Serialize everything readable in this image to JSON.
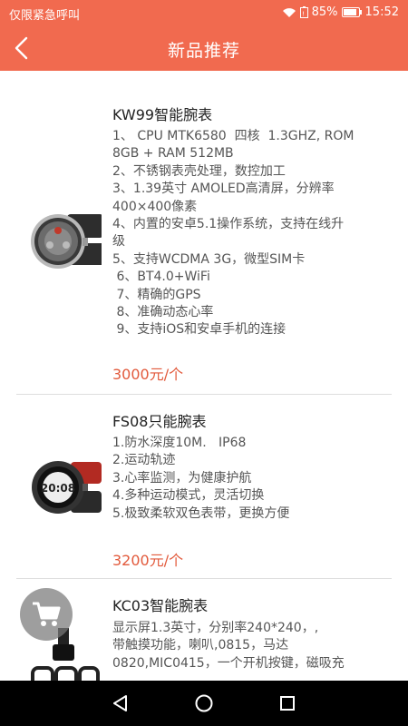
{
  "status": {
    "carrier": "仅限紧急呼叫",
    "battery": "85%",
    "time": "15:52"
  },
  "header": {
    "title": "新品推荐"
  },
  "products": [
    {
      "name": "KW99智能腕表",
      "lines": [
        "1、 CPU MTK6580  四核  1.3GHZ, ROM",
        "8GB + RAM 512MB",
        "2、不锈钢表壳处理，数控加工",
        "3、1.39英寸 AMOLED高清屏，分辨率",
        "400×400像素",
        "4、内置的安卓5.1操作系统，支持在线升",
        "级",
        "5、支持WCDMA 3G，微型SIM卡",
        " 6、BT4.0+WiFi",
        " 7、精确的GPS",
        " 8、准确动态心率",
        " 9、支持iOS和安卓手机的连接"
      ],
      "price": "3000元/个"
    },
    {
      "name": "FS08只能腕表",
      "watch_time": "20:08",
      "lines": [
        "1.防水深度10M.   IP68",
        "2.运动轨迹",
        "3.心率监测，为健康护航",
        "4.多种运动模式，灵活切换",
        "5.极致柔软双色表带，更换方便"
      ],
      "price": "3200元/个"
    },
    {
      "name": "KC03智能腕表",
      "lines": [
        "显示屏1.3英寸，分别率240*240，,",
        "带触摸功能，喇叭,0815，马达",
        "0820,MIC0415，一个开机按键，磁吸充"
      ]
    }
  ],
  "colors": {
    "brand": "#f16a4f",
    "price": "#e25a3c"
  },
  "icons": {
    "back": "back-arrow-icon",
    "cart": "shopping-cart-icon"
  }
}
